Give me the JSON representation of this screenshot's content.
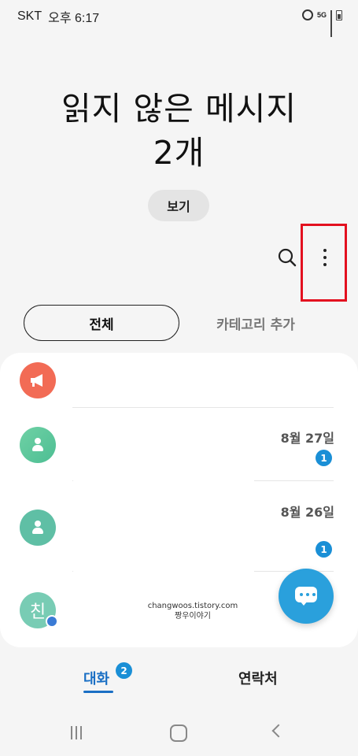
{
  "status_bar": {
    "carrier": "SKT",
    "time": "오후 6:17",
    "network": "5G",
    "icons": [
      "alarm-icon",
      "fiveg-icon",
      "signal-icon",
      "battery-icon"
    ]
  },
  "header": {
    "title_line1": "읽지 않은 메시지",
    "title_line2": "2개",
    "view_button_label": "보기"
  },
  "toolbar": {
    "search_icon": "search-icon",
    "more_icon": "more-options-icon"
  },
  "filters": {
    "all_label": "전체",
    "add_category_label": "카테고리 추가"
  },
  "conversations": [
    {
      "avatar": "megaphone-icon",
      "date": "",
      "unread": ""
    },
    {
      "avatar": "person-icon",
      "date": "8월 27일",
      "unread": "1"
    },
    {
      "avatar": "person-icon",
      "date": "8월 26일",
      "unread": "1"
    },
    {
      "avatar_text": "친",
      "date": "",
      "unread": ""
    }
  ],
  "watermark": {
    "line1": "changwoos.tistory.com",
    "line2": "짱우이야기"
  },
  "fab": {
    "icon": "new-message-icon"
  },
  "bottom_tabs": {
    "chats_label": "대화",
    "chats_badge": "2",
    "contacts_label": "연락처"
  },
  "nav_bar": {
    "icons": [
      "recent-apps-icon",
      "home-icon",
      "back-icon"
    ]
  },
  "colors": {
    "accent": "#1a8fd6",
    "fab": "#2aa0dc",
    "highlight": "#e3101f",
    "megaphone_avatar": "#f26b55",
    "person_avatar": "#5fbfa5"
  }
}
